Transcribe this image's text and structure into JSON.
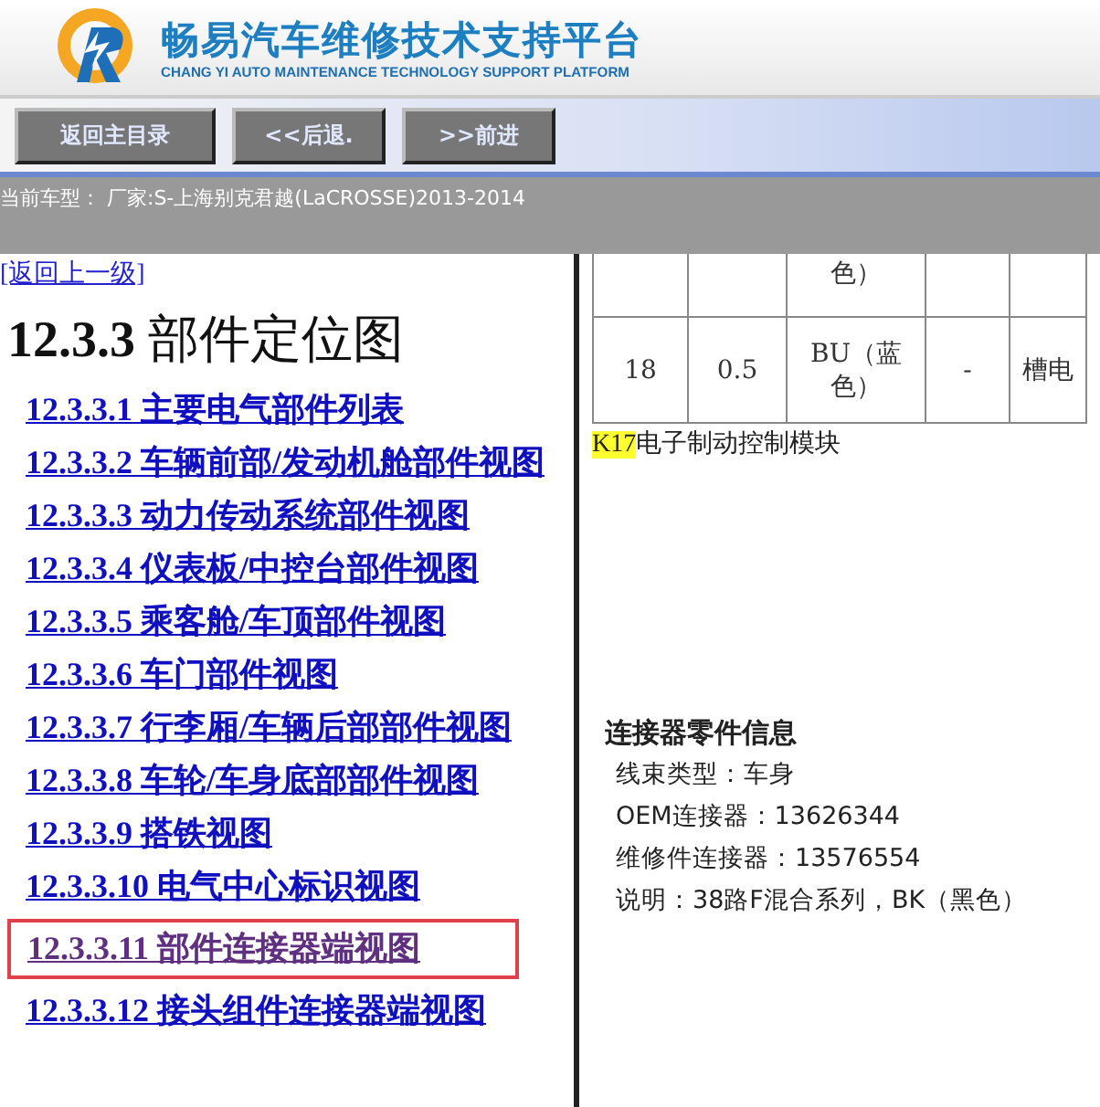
{
  "header": {
    "title": "畅易汽车维修技术支持平台",
    "subtitle": "CHANG YI AUTO MAINTENANCE TECHNOLOGY SUPPORT PLATFORM"
  },
  "toolbar": {
    "buttons": [
      "返回主目录",
      "<<后退.",
      ">>前进"
    ]
  },
  "current_model": "当前车型： 厂家:S-上海别克君越(LaCROSSE)2013-2014",
  "left": {
    "back_link": "[返回上一级]",
    "heading_number": "12.3.3",
    "heading_text": "部件定位图",
    "items": [
      {
        "number": "12.3.3.1",
        "label": "主要电气部件列表",
        "selected": false
      },
      {
        "number": "12.3.3.2",
        "label": "车辆前部/发动机舱部件视图",
        "selected": false
      },
      {
        "number": "12.3.3.3",
        "label": "动力传动系统部件视图",
        "selected": false
      },
      {
        "number": "12.3.3.4",
        "label": "仪表板/中控台部件视图",
        "selected": false
      },
      {
        "number": "12.3.3.5",
        "label": "乘客舱/车顶部件视图",
        "selected": false
      },
      {
        "number": "12.3.3.6",
        "label": "车门部件视图",
        "selected": false
      },
      {
        "number": "12.3.3.7",
        "label": "行李厢/车辆后部部件视图",
        "selected": false
      },
      {
        "number": "12.3.3.8",
        "label": "车轮/车身底部部件视图",
        "selected": false
      },
      {
        "number": "12.3.3.9",
        "label": "搭铁视图",
        "selected": false
      },
      {
        "number": "12.3.3.10",
        "label": "电气中心标识视图",
        "selected": false
      },
      {
        "number": "12.3.3.11",
        "label": "部件连接器端视图",
        "selected": true
      },
      {
        "number": "12.3.3.12",
        "label": "接头组件连接器端视图",
        "selected": false
      }
    ]
  },
  "right": {
    "table": {
      "rows": [
        [
          "",
          "",
          "色）",
          "",
          ""
        ],
        [
          "18",
          "0.5",
          "BU（蓝色）",
          "-",
          "槽电"
        ]
      ]
    },
    "component_code": "K17",
    "component_name": "电子制动控制模块",
    "connector_info": {
      "title": "连接器零件信息",
      "lines": [
        "线束类型：车身",
        "OEM连接器：13626344",
        "维修件连接器：13576554",
        "说明：38路F混合系列，BK（黑色）"
      ]
    }
  }
}
